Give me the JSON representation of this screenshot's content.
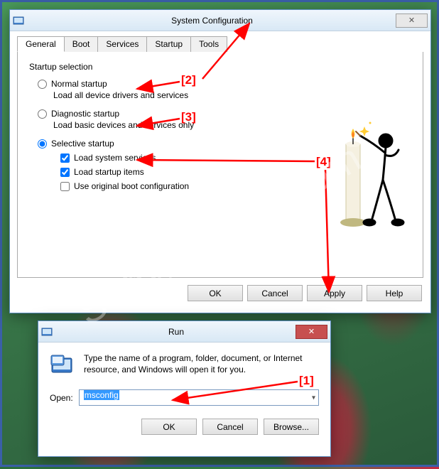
{
  "watermark": "SoftwareOK.com",
  "sysconfig": {
    "title": "System Configuration",
    "tabs": [
      "General",
      "Boot",
      "Services",
      "Startup",
      "Tools"
    ],
    "active_tab": 0,
    "group_label": "Startup selection",
    "options": {
      "normal": {
        "label": "Normal startup",
        "desc": "Load all device drivers and services",
        "checked": false
      },
      "diagnostic": {
        "label": "Diagnostic startup",
        "desc": "Load basic devices and services only",
        "checked": false
      },
      "selective": {
        "label": "Selective startup",
        "checked": true
      }
    },
    "checks": {
      "load_services": {
        "label": "Load system services",
        "checked": true
      },
      "load_startup": {
        "label": "Load startup items",
        "checked": true
      },
      "original_boot": {
        "label": "Use original boot configuration",
        "checked": false
      }
    },
    "buttons": {
      "ok": "OK",
      "cancel": "Cancel",
      "apply": "Apply",
      "help": "Help"
    }
  },
  "run": {
    "title": "Run",
    "desc": "Type the name of a program, folder, document, or Internet resource, and Windows will open it for you.",
    "open_label": "Open:",
    "open_value": "msconfig",
    "buttons": {
      "ok": "OK",
      "cancel": "Cancel",
      "browse": "Browse..."
    }
  },
  "annotations": {
    "a1": "[1]",
    "a2": "[2]",
    "a3": "[3]",
    "a4": "[4]"
  }
}
